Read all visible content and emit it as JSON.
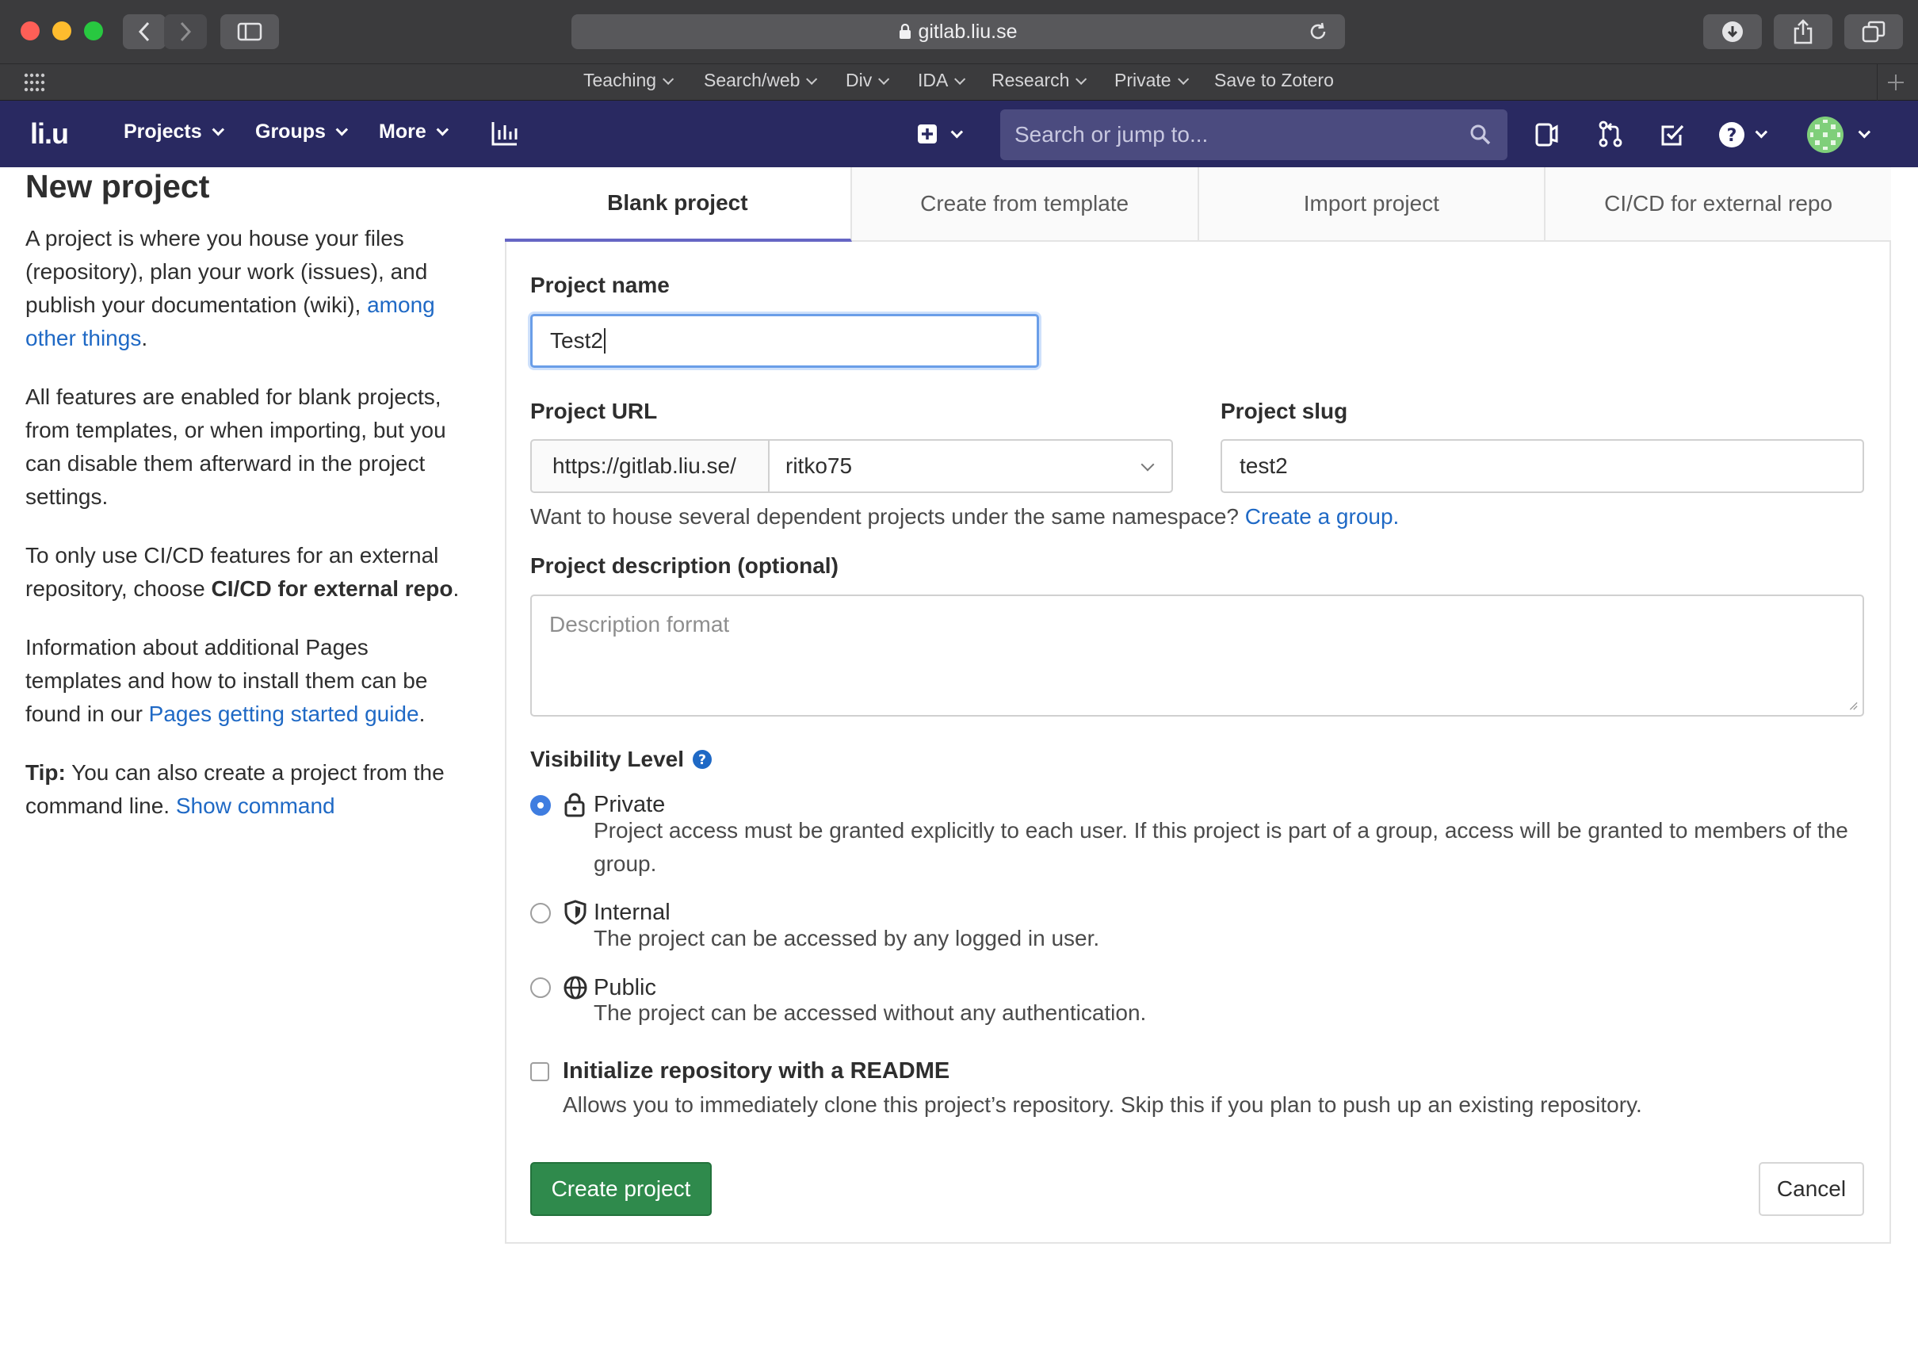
{
  "browser": {
    "url": "gitlab.liu.se",
    "bookmarks": [
      {
        "label": "Teaching"
      },
      {
        "label": "Search/web"
      },
      {
        "label": "Div"
      },
      {
        "label": "IDA"
      },
      {
        "label": "Research"
      },
      {
        "label": "Private"
      },
      {
        "label": "Save to Zotero"
      }
    ]
  },
  "nav": {
    "logo": "li.u",
    "projects": "Projects",
    "groups": "Groups",
    "more": "More",
    "search_placeholder": "Search or jump to..."
  },
  "sidebar": {
    "title": "New project",
    "intro": "A project is where you house your files (repository), plan your work (issues), and publish your documentation (wiki), ",
    "intro_link": "among other things",
    "features": "All features are enabled for blank projects, from templates, or when importing, but you can disable them afterward in the project settings.",
    "cicd_prefix": "To only use CI/CD features for an external repository, choose ",
    "cicd_bold": "CI/CD for external repo",
    "pages_prefix": "Information about additional Pages templates and how to install them can be found in our ",
    "pages_link": "Pages getting started guide",
    "tip_bold": "Tip:",
    "tip_text": " You can also create a project from the command line. ",
    "tip_link": "Show command"
  },
  "tabs": [
    {
      "label": "Blank project",
      "active": true
    },
    {
      "label": "Create from template",
      "active": false
    },
    {
      "label": "Import project",
      "active": false
    },
    {
      "label": "CI/CD for external repo",
      "active": false
    }
  ],
  "form": {
    "project_name_label": "Project name",
    "project_name_value": "Test2",
    "project_url_label": "Project URL",
    "url_prefix": "https://gitlab.liu.se/",
    "namespace": "ritko75",
    "project_slug_label": "Project slug",
    "project_slug_value": "test2",
    "group_hint": "Want to house several dependent projects under the same namespace? ",
    "group_link": "Create a group.",
    "description_label": "Project description (optional)",
    "description_placeholder": "Description format",
    "visibility_label": "Visibility Level",
    "visibility": [
      {
        "title": "Private",
        "desc": "Project access must be granted explicitly to each user. If this project is part of a group, access will be granted to members of the group.",
        "icon": "lock-icon",
        "selected": true
      },
      {
        "title": "Internal",
        "desc": "The project can be accessed by any logged in user.",
        "icon": "shield-icon",
        "selected": false
      },
      {
        "title": "Public",
        "desc": "The project can be accessed without any authentication.",
        "icon": "globe-icon",
        "selected": false
      }
    ],
    "readme_label": "Initialize repository with a README",
    "readme_desc": "Allows you to immediately clone this project’s repository. Skip this if you plan to push up an existing repository.",
    "create_button": "Create project",
    "cancel_button": "Cancel"
  },
  "colors": {
    "nav_bg": "#292961",
    "link": "#1f69c5",
    "primary_button": "#2f8a4c",
    "tab_active_border": "#6666c4"
  }
}
